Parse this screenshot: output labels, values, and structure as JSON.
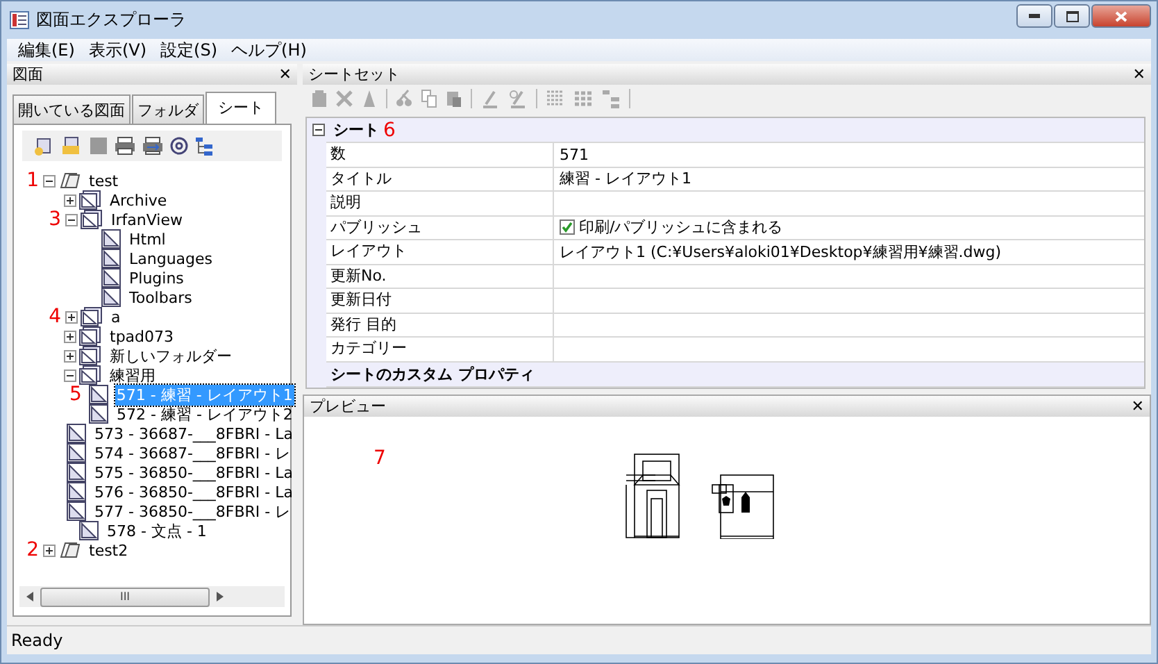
{
  "window": {
    "title": "図面エクスプローラ"
  },
  "menu": [
    "編集(E)",
    "表示(V)",
    "設定(S)",
    "ヘルプ(H)"
  ],
  "left_panel": {
    "title": "図面",
    "close": "✕",
    "tabs": [
      {
        "label": "開いている図面",
        "selected": false
      },
      {
        "label": "フォルダ",
        "selected": false
      },
      {
        "label": "シート",
        "selected": true
      }
    ],
    "tree": [
      {
        "label": "test",
        "kind": "sheetset",
        "expanded": true,
        "selected": false,
        "callout": "1",
        "children": [
          {
            "label": "Archive",
            "kind": "folder",
            "expanded": false,
            "selected": false
          },
          {
            "label": "IrfanView",
            "kind": "folder",
            "expanded": true,
            "selected": false,
            "callout": "3",
            "children": [
              {
                "label": "Html",
                "kind": "sheet",
                "selected": false
              },
              {
                "label": "Languages",
                "kind": "sheet",
                "selected": false
              },
              {
                "label": "Plugins",
                "kind": "sheet",
                "selected": false
              },
              {
                "label": "Toolbars",
                "kind": "sheet",
                "selected": false
              }
            ]
          },
          {
            "label": "a",
            "kind": "folder",
            "expanded": false,
            "selected": false,
            "callout": "4"
          },
          {
            "label": "tpad073",
            "kind": "folder",
            "expanded": false,
            "selected": false
          },
          {
            "label": "新しいフォルダー",
            "kind": "folder",
            "expanded": false,
            "selected": false
          },
          {
            "label": "練習用",
            "kind": "folder",
            "expanded": true,
            "selected": false,
            "children": [
              {
                "label": "571 - 練習 - レイアウト1",
                "kind": "sheet",
                "selected": true,
                "callout": "5"
              },
              {
                "label": "572 - 練習 - レイアウト2",
                "kind": "sheet",
                "selected": false
              }
            ]
          },
          {
            "label": "573 - 36687-___8FBRI - La",
            "kind": "sheet",
            "selected": false
          },
          {
            "label": "574 - 36687-___8FBRI - レ",
            "kind": "sheet",
            "selected": false
          },
          {
            "label": "575 - 36850-___8FBRI - La",
            "kind": "sheet",
            "selected": false
          },
          {
            "label": "576 - 36850-___8FBRI - La",
            "kind": "sheet",
            "selected": false
          },
          {
            "label": "577 - 36850-___8FBRI - レ",
            "kind": "sheet",
            "selected": false
          },
          {
            "label": "578 - 文点 - 1",
            "kind": "sheet",
            "selected": false
          }
        ]
      },
      {
        "label": "test2",
        "kind": "sheetset",
        "expanded": false,
        "selected": false,
        "callout": "2"
      }
    ],
    "scrollbar_grip": "III"
  },
  "sheetset_panel": {
    "title": "シートセット",
    "close": "✕",
    "section": {
      "title": "シート",
      "expanded": true,
      "callout": "6"
    },
    "properties": [
      {
        "label": "数",
        "kind": "text",
        "value": "571"
      },
      {
        "label": "タイトル",
        "kind": "text",
        "value": "練習 - レイアウト1"
      },
      {
        "label": "説明",
        "kind": "text"
      },
      {
        "label": "パブリッシュ",
        "kind": "checkbox",
        "checked": true,
        "value": "印刷/パブリッシュに含まれる"
      },
      {
        "label": "レイアウト",
        "kind": "text",
        "value": "レイアウト1 (C:¥Users¥aloki01¥Desktop¥練習用¥練習.dwg)"
      },
      {
        "label": "更新No.",
        "kind": "text"
      },
      {
        "label": "更新日付",
        "kind": "text"
      },
      {
        "label": "発行 目的",
        "kind": "text"
      },
      {
        "label": "カテゴリー",
        "kind": "text"
      }
    ],
    "custom_section": "シートのカスタム プロパティ"
  },
  "preview_panel": {
    "title": "プレビュー",
    "close": "✕",
    "callout": "7"
  },
  "status_bar": "Ready"
}
